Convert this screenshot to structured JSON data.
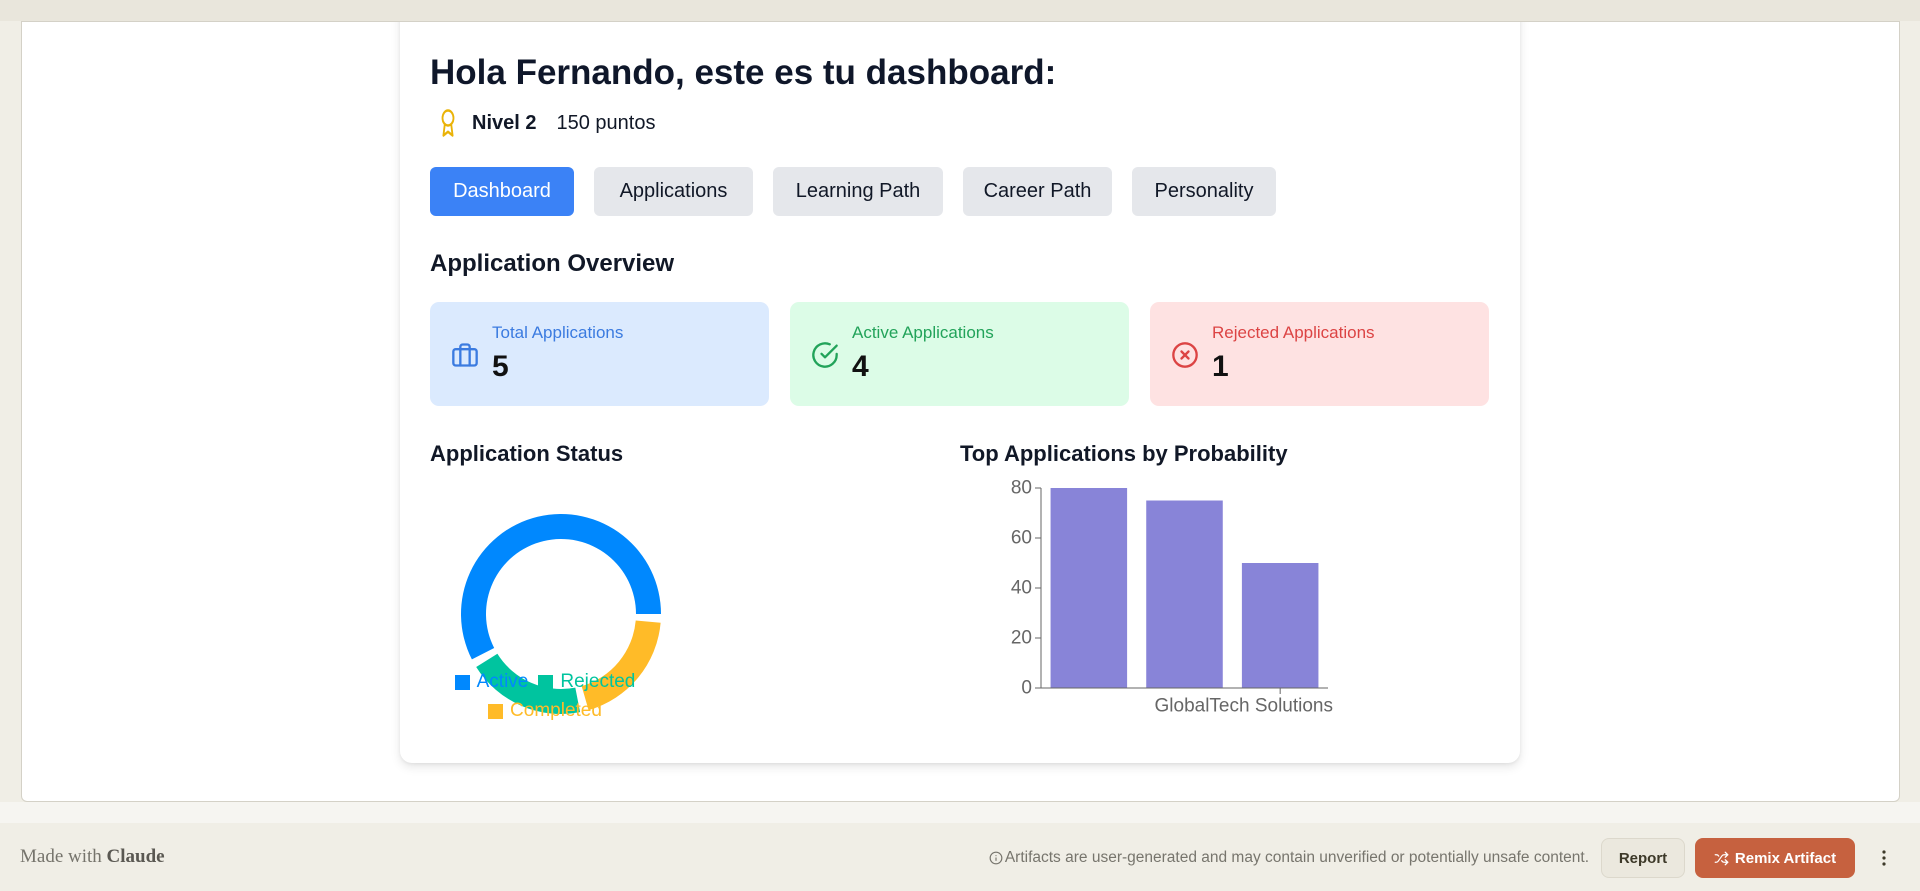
{
  "header": {
    "title": "Hola Fernando, este es tu dashboard:",
    "level": "Nivel 2",
    "points": "150 puntos",
    "level_icon": "award-icon"
  },
  "tabs": [
    {
      "label": "Dashboard",
      "active": true
    },
    {
      "label": "Applications",
      "active": false
    },
    {
      "label": "Learning Path",
      "active": false
    },
    {
      "label": "Career Path",
      "active": false
    },
    {
      "label": "Personality",
      "active": false
    }
  ],
  "overview": {
    "title": "Application Overview",
    "stats": [
      {
        "label": "Total Applications",
        "value": "5",
        "icon": "briefcase-icon",
        "color": "#3b82f6"
      },
      {
        "label": "Active Applications",
        "value": "4",
        "icon": "check-circle-icon",
        "color": "#22c55e"
      },
      {
        "label": "Rejected Applications",
        "value": "1",
        "icon": "x-circle-icon",
        "color": "#ef4444"
      }
    ]
  },
  "status_section": {
    "title": "Application Status"
  },
  "probability_section": {
    "title": "Top Applications by Probability"
  },
  "chart_data": [
    {
      "type": "pie",
      "title": "Application Status",
      "labels": [
        "Active",
        "Rejected",
        "Completed"
      ],
      "values": [
        3,
        1,
        1
      ],
      "colors": [
        "#0088FE",
        "#00C49F",
        "#FFBB28"
      ],
      "legend": "bottom"
    },
    {
      "type": "bar",
      "title": "Top Applications by Probability",
      "categories": [
        null,
        null,
        "GlobalTech Solutions"
      ],
      "values": [
        80,
        75,
        50
      ],
      "color": "#8884d8",
      "xlabel": "",
      "ylabel": "",
      "ylim": [
        0,
        80
      ],
      "yticks": [
        0,
        20,
        40,
        60,
        80
      ],
      "grid": false
    }
  ],
  "footer": {
    "made_with": "Made with",
    "brand": "Claude",
    "disclaimer": "Artifacts are user-generated and may contain unverified or potentially unsafe content.",
    "report_label": "Report",
    "remix_label": "Remix Artifact"
  }
}
